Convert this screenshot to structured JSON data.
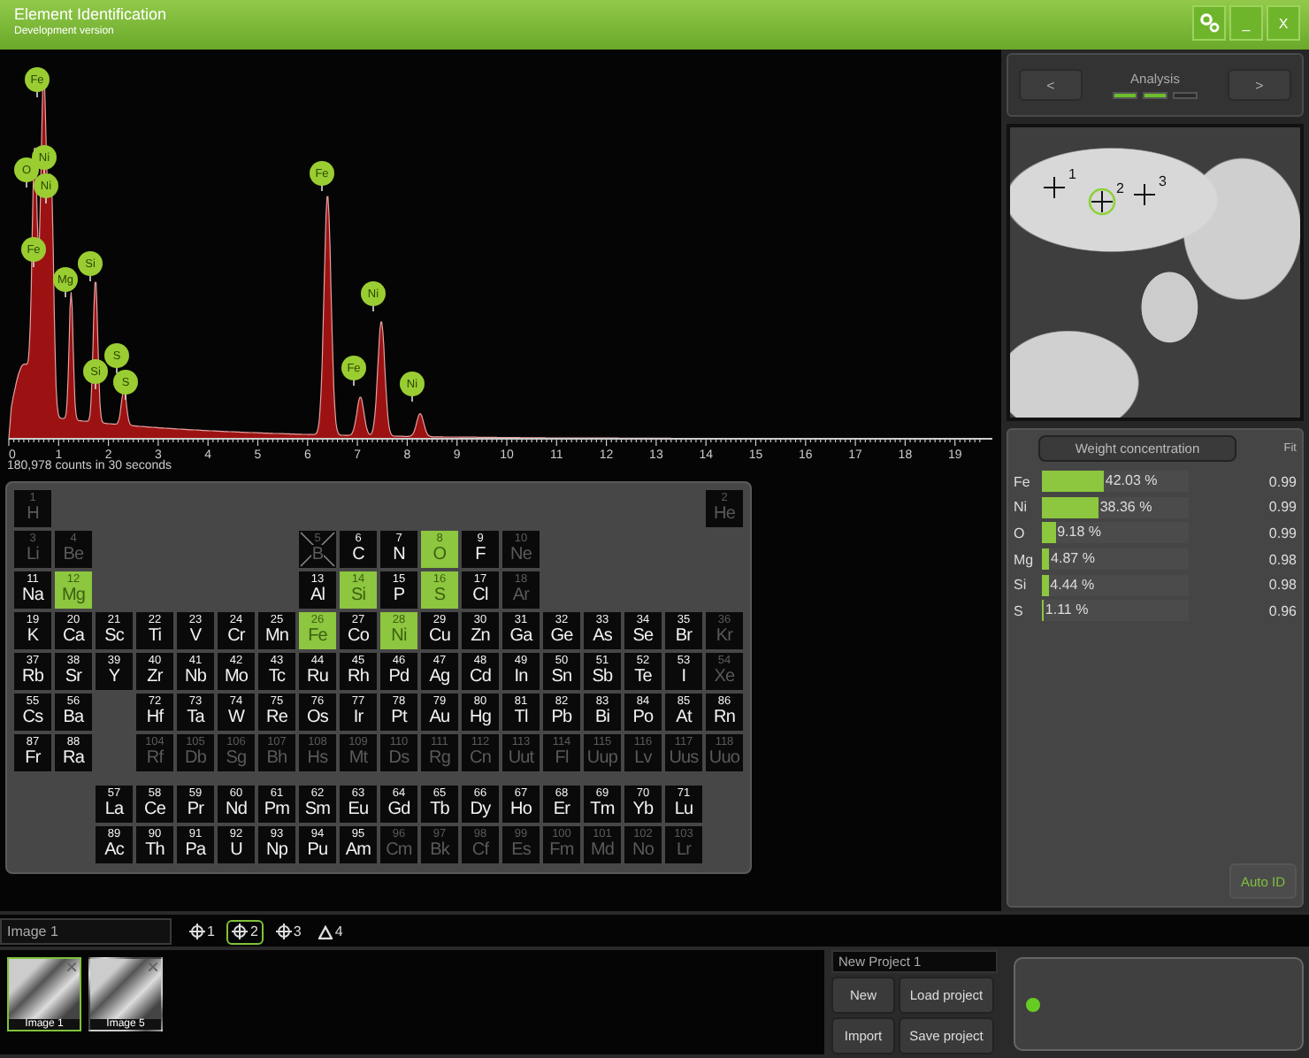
{
  "window": {
    "title": "Element Identification",
    "subtitle": "Development version",
    "buttons": [
      {
        "kind": "settings"
      },
      {
        "kind": "text",
        "label": "_"
      },
      {
        "kind": "text",
        "label": "X"
      }
    ]
  },
  "spectrum": {
    "peak_labels": [
      "Fe",
      "O",
      "Ni",
      "Ni",
      "Fe",
      "Mg",
      "Si",
      "Si",
      "S",
      "S",
      "Fe",
      "Fe",
      "Ni",
      "Ni"
    ],
    "axis_ticks": [
      "0",
      "1",
      "2",
      "3",
      "4",
      "5",
      "6",
      "7",
      "8",
      "9",
      "10",
      "11",
      "12",
      "13",
      "14",
      "15",
      "16",
      "17",
      "18",
      "19"
    ],
    "counts": "180,978 counts in 30 seconds"
  },
  "periodic_table": {
    "elements": [
      {
        "number": "1",
        "symbol": "H",
        "selected": false,
        "disabled": true,
        "crossed": false
      },
      {
        "number": "2",
        "symbol": "He",
        "selected": false,
        "disabled": true,
        "crossed": false
      },
      {
        "number": "3",
        "symbol": "Li",
        "selected": false,
        "disabled": true,
        "crossed": false
      },
      {
        "number": "4",
        "symbol": "Be",
        "selected": false,
        "disabled": true,
        "crossed": false
      },
      {
        "number": "5",
        "symbol": "B",
        "selected": false,
        "disabled": true,
        "crossed": true
      },
      {
        "number": "6",
        "symbol": "C",
        "selected": false,
        "disabled": false,
        "crossed": false
      },
      {
        "number": "7",
        "symbol": "N",
        "selected": false,
        "disabled": false,
        "crossed": false
      },
      {
        "number": "8",
        "symbol": "O",
        "selected": true,
        "disabled": false,
        "crossed": false
      },
      {
        "number": "9",
        "symbol": "F",
        "selected": false,
        "disabled": false,
        "crossed": false
      },
      {
        "number": "10",
        "symbol": "Ne",
        "selected": false,
        "disabled": true,
        "crossed": false
      },
      {
        "number": "11",
        "symbol": "Na",
        "selected": false,
        "disabled": false,
        "crossed": false
      },
      {
        "number": "12",
        "symbol": "Mg",
        "selected": true,
        "disabled": false,
        "crossed": false
      },
      {
        "number": "13",
        "symbol": "Al",
        "selected": false,
        "disabled": false,
        "crossed": false
      },
      {
        "number": "14",
        "symbol": "Si",
        "selected": true,
        "disabled": false,
        "crossed": false
      },
      {
        "number": "15",
        "symbol": "P",
        "selected": false,
        "disabled": false,
        "crossed": false
      },
      {
        "number": "16",
        "symbol": "S",
        "selected": true,
        "disabled": false,
        "crossed": false
      },
      {
        "number": "17",
        "symbol": "Cl",
        "selected": false,
        "disabled": false,
        "crossed": false
      },
      {
        "number": "18",
        "symbol": "Ar",
        "selected": false,
        "disabled": true,
        "crossed": false
      },
      {
        "number": "19",
        "symbol": "K",
        "selected": false,
        "disabled": false,
        "crossed": false
      },
      {
        "number": "20",
        "symbol": "Ca",
        "selected": false,
        "disabled": false,
        "crossed": false
      },
      {
        "number": "21",
        "symbol": "Sc",
        "selected": false,
        "disabled": false,
        "crossed": false
      },
      {
        "number": "22",
        "symbol": "Ti",
        "selected": false,
        "disabled": false,
        "crossed": false
      },
      {
        "number": "23",
        "symbol": "V",
        "selected": false,
        "disabled": false,
        "crossed": false
      },
      {
        "number": "24",
        "symbol": "Cr",
        "selected": false,
        "disabled": false,
        "crossed": false
      },
      {
        "number": "25",
        "symbol": "Mn",
        "selected": false,
        "disabled": false,
        "crossed": false
      },
      {
        "number": "26",
        "symbol": "Fe",
        "selected": true,
        "disabled": false,
        "crossed": false
      },
      {
        "number": "27",
        "symbol": "Co",
        "selected": false,
        "disabled": false,
        "crossed": false
      },
      {
        "number": "28",
        "symbol": "Ni",
        "selected": true,
        "disabled": false,
        "crossed": false
      },
      {
        "number": "29",
        "symbol": "Cu",
        "selected": false,
        "disabled": false,
        "crossed": false
      },
      {
        "number": "30",
        "symbol": "Zn",
        "selected": false,
        "disabled": false,
        "crossed": false
      },
      {
        "number": "31",
        "symbol": "Ga",
        "selected": false,
        "disabled": false,
        "crossed": false
      },
      {
        "number": "32",
        "symbol": "Ge",
        "selected": false,
        "disabled": false,
        "crossed": false
      },
      {
        "number": "33",
        "symbol": "As",
        "selected": false,
        "disabled": false,
        "crossed": false
      },
      {
        "number": "34",
        "symbol": "Se",
        "selected": false,
        "disabled": false,
        "crossed": false
      },
      {
        "number": "35",
        "symbol": "Br",
        "selected": false,
        "disabled": false,
        "crossed": false
      },
      {
        "number": "36",
        "symbol": "Kr",
        "selected": false,
        "disabled": true,
        "crossed": false
      },
      {
        "number": "37",
        "symbol": "Rb",
        "selected": false,
        "disabled": false,
        "crossed": false
      },
      {
        "number": "38",
        "symbol": "Sr",
        "selected": false,
        "disabled": false,
        "crossed": false
      },
      {
        "number": "39",
        "symbol": "Y",
        "selected": false,
        "disabled": false,
        "crossed": false
      },
      {
        "number": "40",
        "symbol": "Zr",
        "selected": false,
        "disabled": false,
        "crossed": false
      },
      {
        "number": "41",
        "symbol": "Nb",
        "selected": false,
        "disabled": false,
        "crossed": false
      },
      {
        "number": "42",
        "symbol": "Mo",
        "selected": false,
        "disabled": false,
        "crossed": false
      },
      {
        "number": "43",
        "symbol": "Tc",
        "selected": false,
        "disabled": false,
        "crossed": false
      },
      {
        "number": "44",
        "symbol": "Ru",
        "selected": false,
        "disabled": false,
        "crossed": false
      },
      {
        "number": "45",
        "symbol": "Rh",
        "selected": false,
        "disabled": false,
        "crossed": false
      },
      {
        "number": "46",
        "symbol": "Pd",
        "selected": false,
        "disabled": false,
        "crossed": false
      },
      {
        "number": "47",
        "symbol": "Ag",
        "selected": false,
        "disabled": false,
        "crossed": false
      },
      {
        "number": "48",
        "symbol": "Cd",
        "selected": false,
        "disabled": false,
        "crossed": false
      },
      {
        "number": "49",
        "symbol": "In",
        "selected": false,
        "disabled": false,
        "crossed": false
      },
      {
        "number": "50",
        "symbol": "Sn",
        "selected": false,
        "disabled": false,
        "crossed": false
      },
      {
        "number": "51",
        "symbol": "Sb",
        "selected": false,
        "disabled": false,
        "crossed": false
      },
      {
        "number": "52",
        "symbol": "Te",
        "selected": false,
        "disabled": false,
        "crossed": false
      },
      {
        "number": "53",
        "symbol": "I",
        "selected": false,
        "disabled": false,
        "crossed": false
      },
      {
        "number": "54",
        "symbol": "Xe",
        "selected": false,
        "disabled": true,
        "crossed": false
      },
      {
        "number": "55",
        "symbol": "Cs",
        "selected": false,
        "disabled": false,
        "crossed": false
      },
      {
        "number": "56",
        "symbol": "Ba",
        "selected": false,
        "disabled": false,
        "crossed": false
      },
      {
        "number": "57",
        "symbol": "La",
        "selected": false,
        "disabled": false,
        "crossed": false
      },
      {
        "number": "58",
        "symbol": "Ce",
        "selected": false,
        "disabled": false,
        "crossed": false
      },
      {
        "number": "59",
        "symbol": "Pr",
        "selected": false,
        "disabled": false,
        "crossed": false
      },
      {
        "number": "60",
        "symbol": "Nd",
        "selected": false,
        "disabled": false,
        "crossed": false
      },
      {
        "number": "61",
        "symbol": "Pm",
        "selected": false,
        "disabled": false,
        "crossed": false
      },
      {
        "number": "62",
        "symbol": "Sm",
        "selected": false,
        "disabled": false,
        "crossed": false
      },
      {
        "number": "63",
        "symbol": "Eu",
        "selected": false,
        "disabled": false,
        "crossed": false
      },
      {
        "number": "64",
        "symbol": "Gd",
        "selected": false,
        "disabled": false,
        "crossed": false
      },
      {
        "number": "65",
        "symbol": "Tb",
        "selected": false,
        "disabled": false,
        "crossed": false
      },
      {
        "number": "66",
        "symbol": "Dy",
        "selected": false,
        "disabled": false,
        "crossed": false
      },
      {
        "number": "67",
        "symbol": "Ho",
        "selected": false,
        "disabled": false,
        "crossed": false
      },
      {
        "number": "68",
        "symbol": "Er",
        "selected": false,
        "disabled": false,
        "crossed": false
      },
      {
        "number": "69",
        "symbol": "Tm",
        "selected": false,
        "disabled": false,
        "crossed": false
      },
      {
        "number": "70",
        "symbol": "Yb",
        "selected": false,
        "disabled": false,
        "crossed": false
      },
      {
        "number": "71",
        "symbol": "Lu",
        "selected": false,
        "disabled": false,
        "crossed": false
      },
      {
        "number": "72",
        "symbol": "Hf",
        "selected": false,
        "disabled": false,
        "crossed": false
      },
      {
        "number": "73",
        "symbol": "Ta",
        "selected": false,
        "disabled": false,
        "crossed": false
      },
      {
        "number": "74",
        "symbol": "W",
        "selected": false,
        "disabled": false,
        "crossed": false
      },
      {
        "number": "75",
        "symbol": "Re",
        "selected": false,
        "disabled": false,
        "crossed": false
      },
      {
        "number": "76",
        "symbol": "Os",
        "selected": false,
        "disabled": false,
        "crossed": false
      },
      {
        "number": "77",
        "symbol": "Ir",
        "selected": false,
        "disabled": false,
        "crossed": false
      },
      {
        "number": "78",
        "symbol": "Pt",
        "selected": false,
        "disabled": false,
        "crossed": false
      },
      {
        "number": "79",
        "symbol": "Au",
        "selected": false,
        "disabled": false,
        "crossed": false
      },
      {
        "number": "80",
        "symbol": "Hg",
        "selected": false,
        "disabled": false,
        "crossed": false
      },
      {
        "number": "81",
        "symbol": "Tl",
        "selected": false,
        "disabled": false,
        "crossed": false
      },
      {
        "number": "82",
        "symbol": "Pb",
        "selected": false,
        "disabled": false,
        "crossed": false
      },
      {
        "number": "83",
        "symbol": "Bi",
        "selected": false,
        "disabled": false,
        "crossed": false
      },
      {
        "number": "84",
        "symbol": "Po",
        "selected": false,
        "disabled": false,
        "crossed": false
      },
      {
        "number": "85",
        "symbol": "At",
        "selected": false,
        "disabled": false,
        "crossed": false
      },
      {
        "number": "86",
        "symbol": "Rn",
        "selected": false,
        "disabled": false,
        "crossed": false
      },
      {
        "number": "87",
        "symbol": "Fr",
        "selected": false,
        "disabled": false,
        "crossed": false
      },
      {
        "number": "88",
        "symbol": "Ra",
        "selected": false,
        "disabled": false,
        "crossed": false
      },
      {
        "number": "89",
        "symbol": "Ac",
        "selected": false,
        "disabled": false,
        "crossed": false
      },
      {
        "number": "90",
        "symbol": "Th",
        "selected": false,
        "disabled": false,
        "crossed": false
      },
      {
        "number": "91",
        "symbol": "Pa",
        "selected": false,
        "disabled": false,
        "crossed": false
      },
      {
        "number": "92",
        "symbol": "U",
        "selected": false,
        "disabled": false,
        "crossed": false
      },
      {
        "number": "93",
        "symbol": "Np",
        "selected": false,
        "disabled": false,
        "crossed": false
      },
      {
        "number": "94",
        "symbol": "Pu",
        "selected": false,
        "disabled": false,
        "crossed": false
      },
      {
        "number": "95",
        "symbol": "Am",
        "selected": false,
        "disabled": false,
        "crossed": false
      },
      {
        "number": "96",
        "symbol": "Cm",
        "selected": false,
        "disabled": true,
        "crossed": false
      },
      {
        "number": "97",
        "symbol": "Bk",
        "selected": false,
        "disabled": true,
        "crossed": false
      },
      {
        "number": "98",
        "symbol": "Cf",
        "selected": false,
        "disabled": true,
        "crossed": false
      },
      {
        "number": "99",
        "symbol": "Es",
        "selected": false,
        "disabled": true,
        "crossed": false
      },
      {
        "number": "100",
        "symbol": "Fm",
        "selected": false,
        "disabled": true,
        "crossed": false
      },
      {
        "number": "101",
        "symbol": "Md",
        "selected": false,
        "disabled": true,
        "crossed": false
      },
      {
        "number": "102",
        "symbol": "No",
        "selected": false,
        "disabled": true,
        "crossed": false
      },
      {
        "number": "103",
        "symbol": "Lr",
        "selected": false,
        "disabled": true,
        "crossed": false
      },
      {
        "number": "104",
        "symbol": "Rf",
        "selected": false,
        "disabled": true,
        "crossed": false
      },
      {
        "number": "105",
        "symbol": "Db",
        "selected": false,
        "disabled": true,
        "crossed": false
      },
      {
        "number": "106",
        "symbol": "Sg",
        "selected": false,
        "disabled": true,
        "crossed": false
      },
      {
        "number": "107",
        "symbol": "Bh",
        "selected": false,
        "disabled": true,
        "crossed": false
      },
      {
        "number": "108",
        "symbol": "Hs",
        "selected": false,
        "disabled": true,
        "crossed": false
      },
      {
        "number": "109",
        "symbol": "Mt",
        "selected": false,
        "disabled": true,
        "crossed": false
      },
      {
        "number": "110",
        "symbol": "Ds",
        "selected": false,
        "disabled": true,
        "crossed": false
      },
      {
        "number": "111",
        "symbol": "Rg",
        "selected": false,
        "disabled": true,
        "crossed": false
      },
      {
        "number": "112",
        "symbol": "Cn",
        "selected": false,
        "disabled": true,
        "crossed": false
      },
      {
        "number": "113",
        "symbol": "Uut",
        "selected": false,
        "disabled": true,
        "crossed": false
      },
      {
        "number": "114",
        "symbol": "Fl",
        "selected": false,
        "disabled": true,
        "crossed": false
      },
      {
        "number": "115",
        "symbol": "Uup",
        "selected": false,
        "disabled": true,
        "crossed": false
      },
      {
        "number": "116",
        "symbol": "Lv",
        "selected": false,
        "disabled": true,
        "crossed": false
      },
      {
        "number": "117",
        "symbol": "Uus",
        "selected": false,
        "disabled": true,
        "crossed": false
      },
      {
        "number": "118",
        "symbol": "Uuo",
        "selected": false,
        "disabled": true,
        "crossed": false
      }
    ]
  },
  "analysis": {
    "title": "Analysis",
    "prev": "<",
    "next": ">",
    "steps": [
      {
        "done": true
      },
      {
        "done": true
      },
      {
        "done": false
      }
    ]
  },
  "image": {
    "markers": [
      {
        "label": "1",
        "selected": false
      },
      {
        "label": "2",
        "selected": true
      },
      {
        "label": "3",
        "selected": false
      }
    ]
  },
  "concentration": {
    "title": "Weight concentration",
    "fit_header": "Fit",
    "rows": [
      {
        "element": "Fe",
        "level": 0.4203,
        "value": "42.03 %",
        "fit": "0.99"
      },
      {
        "element": "Ni",
        "level": 0.3836,
        "value": "38.36 %",
        "fit": "0.99"
      },
      {
        "element": "O",
        "level": 0.0918,
        "value": "9.18 %",
        "fit": "0.99"
      },
      {
        "element": "Mg",
        "level": 0.0487,
        "value": "4.87 %",
        "fit": "0.98"
      },
      {
        "element": "Si",
        "level": 0.0444,
        "value": "4.44 %",
        "fit": "0.98"
      },
      {
        "element": "S",
        "level": 0.0111,
        "value": "1.11 %",
        "fit": "0.96"
      }
    ],
    "auto_id": "Auto ID"
  },
  "image_name": {
    "value": "Image 1"
  },
  "view_tabs": [
    {
      "kind": "crosshair",
      "label": "1",
      "selected": false
    },
    {
      "kind": "crosshair",
      "label": "2",
      "selected": true
    },
    {
      "kind": "crosshair",
      "label": "3",
      "selected": false
    },
    {
      "kind": "triangle",
      "label": "4",
      "selected": false
    }
  ],
  "thumbnails": [
    {
      "label": "Image 1",
      "selected": true
    },
    {
      "label": "Image 5",
      "selected": false
    }
  ],
  "project": {
    "name": "New Project 1",
    "buttons": [
      "New",
      "Load project",
      "Import",
      "Save project"
    ]
  },
  "status": {
    "color": "#66cc22"
  }
}
